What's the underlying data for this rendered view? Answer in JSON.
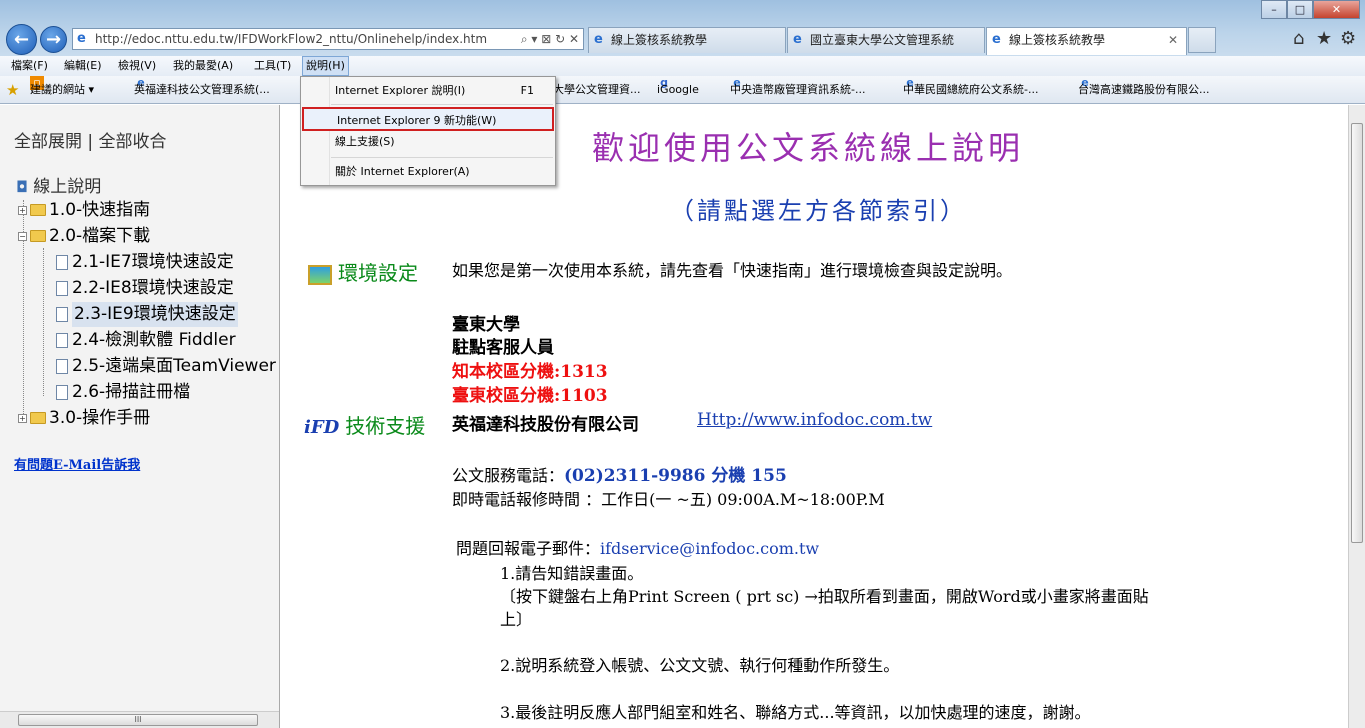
{
  "browser": {
    "back_label": "←",
    "forward_label": "→",
    "address": "http://edoc.nttu.edu.tw/IFDWorkFlow2_nttu/Onlinehelp/index.htm",
    "address_tools": "⌕ ▾ ⊠ ↻ ✕",
    "tabs": [
      {
        "label": "線上簽核系統教學"
      },
      {
        "label": "國立臺東大學公文管理系統"
      },
      {
        "label": "線上簽核系統教學",
        "close": "✕"
      }
    ],
    "home_icon": "⌂",
    "star_icon": "★",
    "gear_icon": "⚙",
    "window": {
      "min": "–",
      "max": "□",
      "close": "✕"
    }
  },
  "menubar": {
    "items": [
      "檔案(F)",
      "編輯(E)",
      "檢視(V)",
      "我的最愛(A)",
      "工具(T)",
      "說明(H)"
    ]
  },
  "favbar": {
    "items": [
      "建議的網站 ▾",
      "英福達科技公文管理系統(...",
      "大學公文管理資...",
      "iGoogle",
      "中央造幣廠管理資訊系統-...",
      "中華民國總統府公文系統-...",
      "台灣高速鐵路股份有限公..."
    ]
  },
  "help_menu": {
    "items": [
      {
        "label": "Internet Explorer 說明(I)",
        "shortcut": "F1"
      },
      {
        "label": "Internet Explorer 9 新功能(W)"
      },
      {
        "label": "線上支援(S)"
      },
      {
        "label": "關於 Internet Explorer(A)"
      }
    ]
  },
  "left": {
    "expand_collapse": "全部展開 | 全部收合",
    "root": "線上說明",
    "nodes": [
      "1.0-快速指南",
      "2.0-檔案下載",
      "2.1-IE7環境快速設定",
      "2.2-IE8環境快速設定",
      "2.3-IE9環境快速設定",
      "2.4-檢測軟體 Fiddler",
      "2.5-遠端桌面TeamViewer",
      "2.6-掃描註冊檔",
      "3.0-操作手冊"
    ],
    "mail_link": "有問題E-Mail告訴我",
    "scroll_label": "III"
  },
  "main": {
    "title": "歡迎使用公文系統線上說明",
    "subtitle": "（請點選左方各節索引）",
    "env_heading": "環境設定",
    "env_text": "如果您是第一次使用本系統，請先查看「快速指南」進行環境檢查與設定說明。",
    "school": "臺東大學",
    "staff": "駐點客服人員",
    "ext1": "知本校區分機:1313",
    "ext2": "臺東校區分機:1103",
    "tech_heading": "技術支援",
    "company": "英福達科技股份有限公司",
    "company_url": "Http://www.infodoc.com.tw",
    "phone_label": "公文服務電話：",
    "phone": "(02)2311-9986 分機 155",
    "hours": "即時電話報修時間 ：工作日(一 ~五) 09:00A.M~18:00P.M",
    "email_label": "問題回報電子郵件：",
    "email": "ifdservice@infodoc.com.tw",
    "step1": "1.請告知錯誤畫面。",
    "step1_detail_a": "〔按下鍵盤右上角Print Screen ( prt sc) →拍取所看到畫面，開啟Word或小畫家將畫面貼",
    "step1_detail_b": "上〕",
    "step2": "2.說明系統登入帳號、公文文號、執行何種動作所發生。",
    "step3": "3.最後註明反應人部門組室和姓名、聯絡方式...等資訊，以加快處理的速度，謝謝。"
  }
}
